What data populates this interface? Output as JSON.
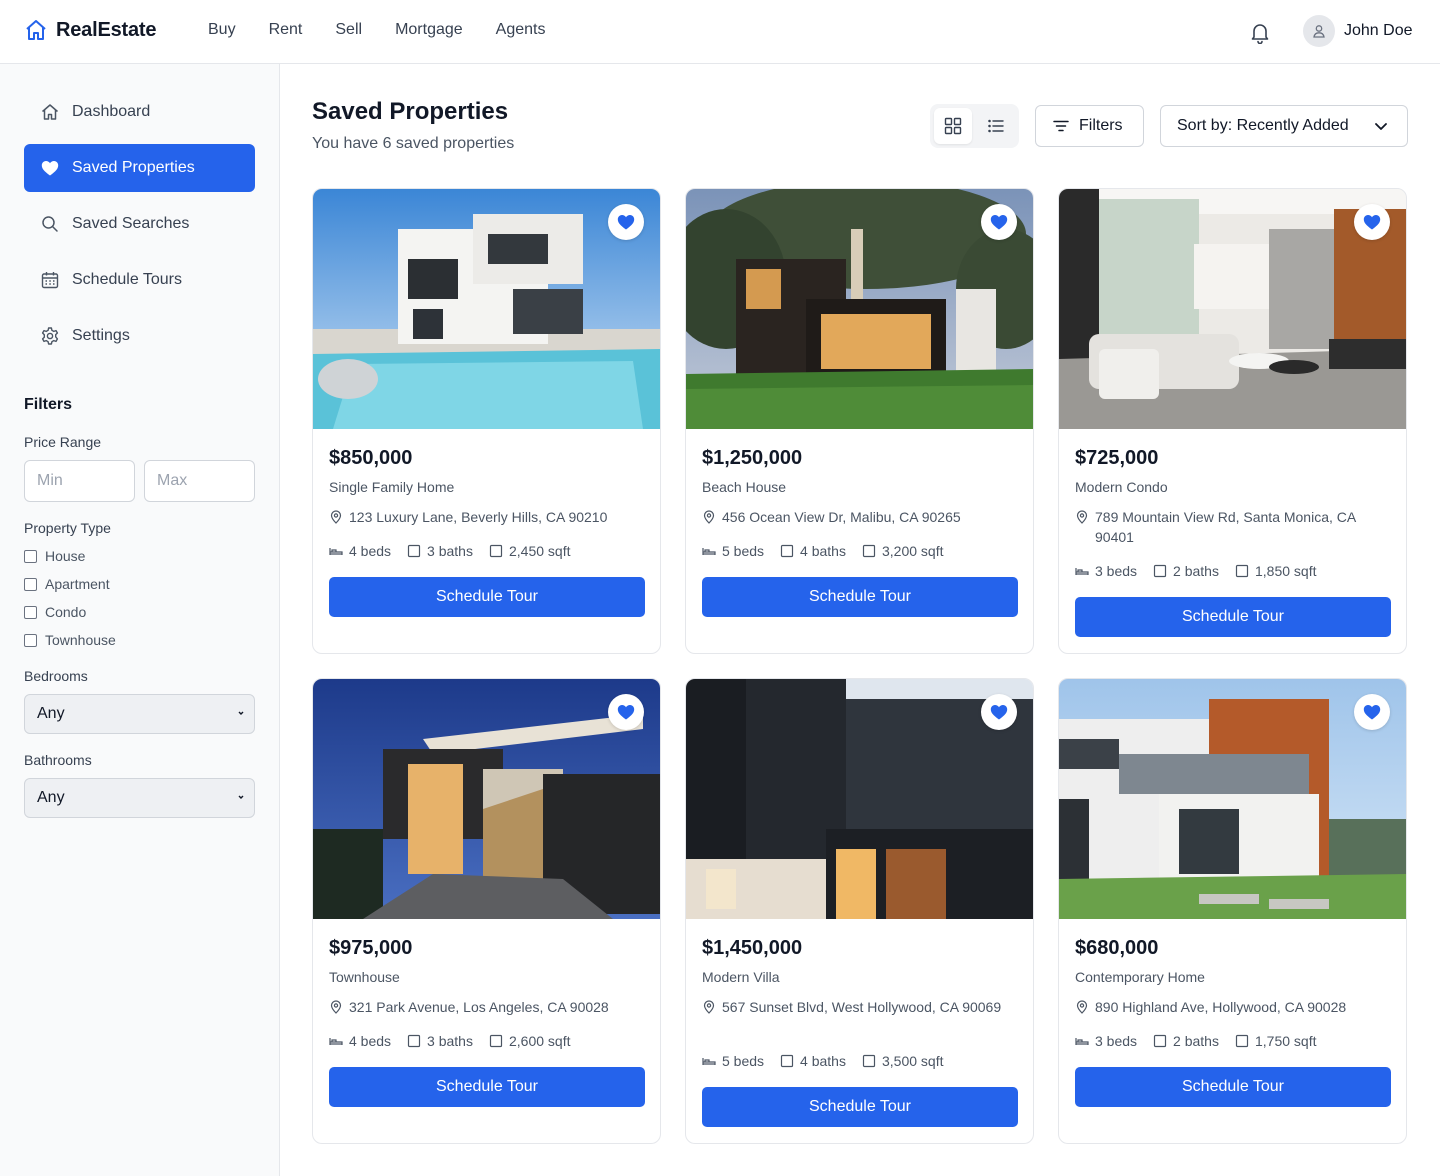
{
  "app": {
    "brand": "RealEstate"
  },
  "nav": [
    "Buy",
    "Rent",
    "Sell",
    "Mortgage",
    "Agents"
  ],
  "user": {
    "name": "John Doe"
  },
  "sidebar": {
    "items": [
      {
        "label": "Dashboard",
        "icon": "home-icon"
      },
      {
        "label": "Saved Properties",
        "icon": "heart-icon",
        "active": true
      },
      {
        "label": "Saved Searches",
        "icon": "search-icon"
      },
      {
        "label": "Schedule Tours",
        "icon": "calendar-icon"
      },
      {
        "label": "Settings",
        "icon": "gear-icon"
      }
    ],
    "filters_title": "Filters",
    "price_range_label": "Price Range",
    "price_min_placeholder": "Min",
    "price_max_placeholder": "Max",
    "property_type_label": "Property Type",
    "property_types": [
      "House",
      "Apartment",
      "Condo",
      "Townhouse"
    ],
    "bedrooms_label": "Bedrooms",
    "bedrooms_value": "Any",
    "bathrooms_label": "Bathrooms",
    "bathrooms_value": "Any"
  },
  "main": {
    "title": "Saved Properties",
    "subtitle": "You have 6 saved properties",
    "filters_button": "Filters",
    "sort_label": "Sort by: Recently Added",
    "view_mode": "grid"
  },
  "colors": {
    "accent": "#2563eb",
    "text": "#111827",
    "muted": "#4b5563",
    "border": "#e5e7eb"
  },
  "properties": [
    {
      "price": "$850,000",
      "type": "Single Family Home",
      "address": "123 Luxury Lane, Beverly Hills, CA 90210",
      "beds": "4 beds",
      "baths": "3 baths",
      "sqft": "2,450 sqft",
      "cta": "Schedule Tour",
      "image": "white modern villa with pool"
    },
    {
      "price": "$1,250,000",
      "type": "Beach House",
      "address": "456 Ocean View Dr, Malibu, CA 90265",
      "beds": "5 beds",
      "baths": "4 baths",
      "sqft": "3,200 sqft",
      "cta": "Schedule Tour",
      "image": "dark house with large tree at dusk"
    },
    {
      "price": "$725,000",
      "type": "Modern Condo",
      "address": "789 Mountain View Rd, Santa Monica, CA 90401",
      "beds": "3 beds",
      "baths": "2 baths",
      "sqft": "1,850 sqft",
      "cta": "Schedule Tour",
      "image": "bright living room interior"
    },
    {
      "price": "$975,000",
      "type": "Townhouse",
      "address": "321 Park Avenue, Los Angeles, CA 90028",
      "beds": "4 beds",
      "baths": "3 baths",
      "sqft": "2,600 sqft",
      "cta": "Schedule Tour",
      "image": "townhouse at night"
    },
    {
      "price": "$1,450,000",
      "type": "Modern Villa",
      "address": "567 Sunset Blvd, West Hollywood, CA 90069",
      "beds": "5 beds",
      "baths": "4 baths",
      "sqft": "3,500 sqft",
      "cta": "Schedule Tour",
      "image": "dark modern villa facade"
    },
    {
      "price": "$680,000",
      "type": "Contemporary Home",
      "address": "890 Highland Ave, Hollywood, CA 90028",
      "beds": "3 beds",
      "baths": "2 baths",
      "sqft": "1,750 sqft",
      "cta": "Schedule Tour",
      "image": "white and wood contemporary house"
    }
  ]
}
